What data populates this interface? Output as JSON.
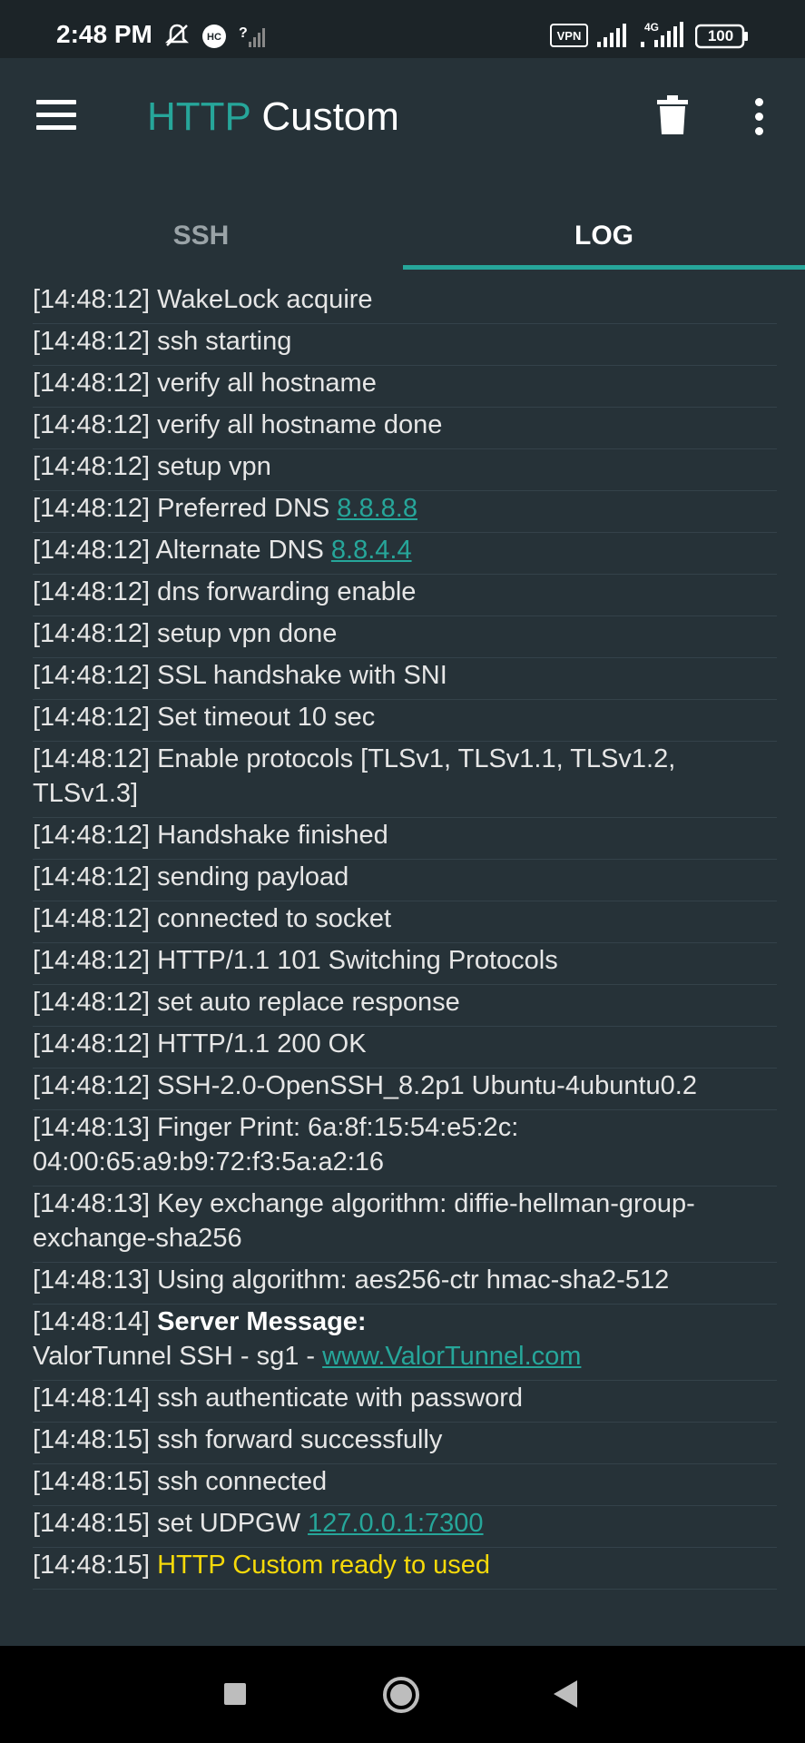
{
  "status_bar": {
    "time": "2:48 PM",
    "battery": "100",
    "vpn": "VPN",
    "network": "4G"
  },
  "app": {
    "title_part1": "HTTP",
    "title_part2": "Custom"
  },
  "tabs": [
    {
      "label": "SSH"
    },
    {
      "label": "LOG"
    }
  ],
  "log": [
    {
      "time": "[14:48:12]",
      "msg": "WakeLock acquire"
    },
    {
      "time": "[14:48:12]",
      "msg": "ssh starting"
    },
    {
      "time": "[14:48:12]",
      "msg": "verify all hostname"
    },
    {
      "time": "[14:48:12]",
      "msg": "verify all hostname done"
    },
    {
      "time": "[14:48:12]",
      "msg": "setup vpn"
    },
    {
      "time": "[14:48:12]",
      "msg": "Preferred DNS ",
      "link": "8.8.8.8"
    },
    {
      "time": "[14:48:12]",
      "msg": "Alternate DNS ",
      "link": "8.8.4.4"
    },
    {
      "time": "[14:48:12]",
      "msg": "dns forwarding enable"
    },
    {
      "time": "[14:48:12]",
      "msg": "setup vpn done"
    },
    {
      "time": "[14:48:12]",
      "msg": "SSL handshake with SNI"
    },
    {
      "time": "[14:48:12]",
      "msg": "Set timeout 10 sec"
    },
    {
      "time": "[14:48:12]",
      "msg": "Enable protocols [TLSv1, TLSv1.1, TLSv1.2, TLSv1.3]"
    },
    {
      "time": "[14:48:12]",
      "msg": "Handshake finished"
    },
    {
      "time": "[14:48:12]",
      "msg": "sending payload"
    },
    {
      "time": "[14:48:12]",
      "msg": "connected to socket"
    },
    {
      "time": "[14:48:12]",
      "msg": "HTTP/1.1 101 Switching Protocols"
    },
    {
      "time": "[14:48:12]",
      "msg": "set auto replace response"
    },
    {
      "time": "[14:48:12]",
      "msg": "HTTP/1.1 200 OK"
    },
    {
      "time": "[14:48:12]",
      "msg": "SSH-2.0-OpenSSH_8.2p1 Ubuntu-4ubuntu0.2"
    },
    {
      "time": "[14:48:13]",
      "msg": "Finger Print: 6a:8f:15:54:e5:2c: 04:00:65:a9:b9:72:f3:5a:a2:16"
    },
    {
      "time": "[14:48:13]",
      "msg": "Key exchange algorithm: diffie-hellman-group-exchange-sha256"
    },
    {
      "time": "[14:48:13]",
      "msg": "Using algorithm: aes256-ctr hmac-sha2-512"
    },
    {
      "time": "[14:48:14]",
      "bold": "Server Message:",
      "msg2": "ValorTunnel SSH - sg1 - ",
      "link": "www.ValorTunnel.com"
    },
    {
      "time": "[14:48:14]",
      "msg": "ssh authenticate with password"
    },
    {
      "time": "[14:48:15]",
      "msg": "ssh forward successfully"
    },
    {
      "time": "[14:48:15]",
      "msg": "ssh connected"
    },
    {
      "time": "[14:48:15]",
      "msg": "set UDPGW ",
      "link": "127.0.0.1:7300"
    },
    {
      "time": "[14:48:15]",
      "ok": "HTTP Custom ready to used"
    }
  ],
  "colors": {
    "accent": "#26a69a",
    "background": "#263238",
    "ready": "#f5d90a"
  }
}
